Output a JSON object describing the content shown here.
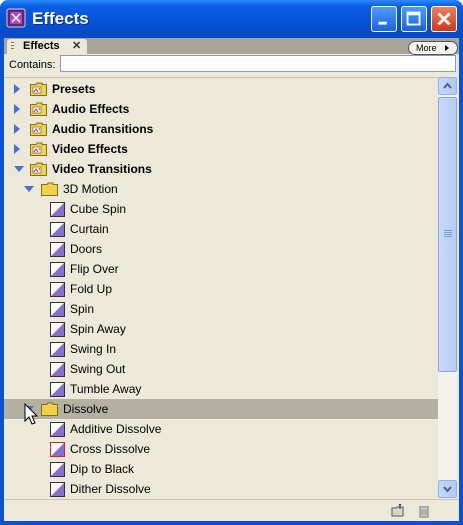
{
  "window": {
    "title": "Effects"
  },
  "panel": {
    "tab_label": "Effects",
    "tab_close": "✕",
    "more_label": "More"
  },
  "search": {
    "label": "Contains:",
    "value": ""
  },
  "tree": [
    {
      "label": "Presets",
      "level": 0,
      "kind": "bin",
      "expanded": false
    },
    {
      "label": "Audio Effects",
      "level": 0,
      "kind": "bin",
      "expanded": false
    },
    {
      "label": "Audio Transitions",
      "level": 0,
      "kind": "bin",
      "expanded": false
    },
    {
      "label": "Video Effects",
      "level": 0,
      "kind": "bin",
      "expanded": false
    },
    {
      "label": "Video Transitions",
      "level": 0,
      "kind": "bin",
      "expanded": true
    },
    {
      "label": "3D Motion",
      "level": 1,
      "kind": "folder",
      "expanded": true
    },
    {
      "label": "Cube Spin",
      "level": 2,
      "kind": "effect"
    },
    {
      "label": "Curtain",
      "level": 2,
      "kind": "effect"
    },
    {
      "label": "Doors",
      "level": 2,
      "kind": "effect"
    },
    {
      "label": "Flip Over",
      "level": 2,
      "kind": "effect"
    },
    {
      "label": "Fold Up",
      "level": 2,
      "kind": "effect"
    },
    {
      "label": "Spin",
      "level": 2,
      "kind": "effect"
    },
    {
      "label": "Spin Away",
      "level": 2,
      "kind": "effect"
    },
    {
      "label": "Swing In",
      "level": 2,
      "kind": "effect"
    },
    {
      "label": "Swing Out",
      "level": 2,
      "kind": "effect"
    },
    {
      "label": "Tumble Away",
      "level": 2,
      "kind": "effect"
    },
    {
      "label": "Dissolve",
      "level": 1,
      "kind": "folder",
      "expanded": true,
      "selected": true
    },
    {
      "label": "Additive Dissolve",
      "level": 2,
      "kind": "effect"
    },
    {
      "label": "Cross Dissolve",
      "level": 2,
      "kind": "effect",
      "default": true
    },
    {
      "label": "Dip to Black",
      "level": 2,
      "kind": "effect"
    },
    {
      "label": "Dither Dissolve",
      "level": 2,
      "kind": "effect"
    }
  ],
  "icons": {
    "app": "premiere-app-icon",
    "minimize": "minimize-icon",
    "maximize": "maximize-icon",
    "close": "close-icon",
    "new_bin": "new-bin-icon",
    "delete": "trash-icon"
  },
  "colors": {
    "titlebar": "#0652d8",
    "panel_bg": "#ece9d8",
    "selection": "#b4b1a2",
    "disclosure": "#4a6fd0",
    "folder": "#f2d24b",
    "effect": "#8a6fd0"
  }
}
